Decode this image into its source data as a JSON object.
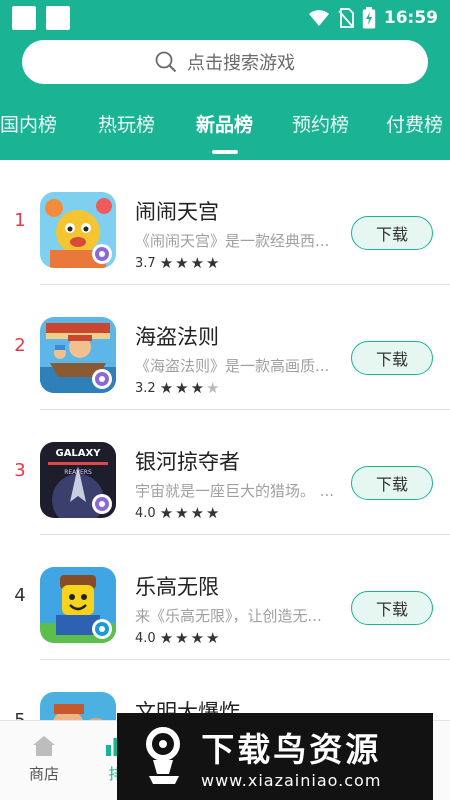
{
  "status_bar": {
    "time": "16:59"
  },
  "search": {
    "placeholder": "点击搜索游戏"
  },
  "tabs": [
    "国内榜",
    "热玩榜",
    "新品榜",
    "预约榜",
    "付费榜"
  ],
  "active_tab": "新品榜",
  "apps": [
    {
      "rank": "1",
      "name": "闹闹天宫",
      "desc": "《闹闹天宫》是一款经典西...",
      "rating": "3.7",
      "stars": 4,
      "download": "下载"
    },
    {
      "rank": "2",
      "name": "海盗法则",
      "desc": "《海盗法则》是一款高画质...",
      "rating": "3.2",
      "stars": 3.5,
      "download": "下载"
    },
    {
      "rank": "3",
      "name": "银河掠夺者",
      "desc": "宇宙就是一座巨大的猎场。 ...",
      "rating": "4.0",
      "stars": 4,
      "download": "下载"
    },
    {
      "rank": "4",
      "name": "乐高无限",
      "desc": "来《乐高无限》，让创造无...",
      "rating": "4.0",
      "stars": 4,
      "download": "下载"
    },
    {
      "rank": "5",
      "name": "文明大爆炸"
    }
  ],
  "icon_texts": {
    "galaxy_title": "GALAXY",
    "galaxy_sub": "REAVERS"
  },
  "bottom_nav": [
    {
      "label": "商店",
      "icon": "house-icon"
    },
    {
      "label": "排",
      "icon": "ranking-icon"
    }
  ],
  "watermark": {
    "title": "下载鸟资源",
    "url": "www.xiazainiao.com"
  },
  "colors": {
    "header": "#1ab394",
    "rank_top": "#e03b4b",
    "rank_other": "#333333",
    "button_border": "#1ab394",
    "button_bg": "#e6f7f2"
  }
}
